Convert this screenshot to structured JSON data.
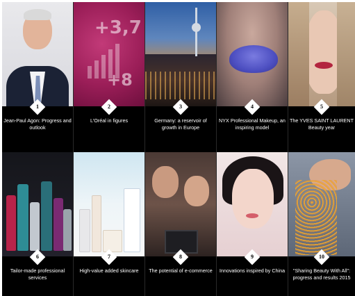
{
  "tiles_row1": [
    {
      "num": "1",
      "caption": "Jean-Paul Agon: Progress and outlook"
    },
    {
      "num": "2",
      "caption": "L'Oréal in figures",
      "figure_main": "+3,7",
      "figure_secondary": "+8"
    },
    {
      "num": "3",
      "caption": "Germany: a reservoir of growth in Europe"
    },
    {
      "num": "4",
      "caption": "NYX Professional Makeup, an inspiring model"
    },
    {
      "num": "5",
      "caption": "The YVES SAINT LAURENT Beauty year"
    }
  ],
  "tiles_row2": [
    {
      "num": "6",
      "caption": "Tailor-made professional services"
    },
    {
      "num": "7",
      "caption": "High-value added skincare"
    },
    {
      "num": "8",
      "caption": "The potential of e-commerce"
    },
    {
      "num": "9",
      "caption": "Innovations inspired by China"
    },
    {
      "num": "10",
      "caption": "\"Sharing Beauty With All\": progress and results 2015"
    }
  ],
  "colors": {
    "background": "#000000",
    "caption_text": "#ffffff",
    "badge": "#ffffff",
    "figures_tile": "#9b1e58"
  }
}
